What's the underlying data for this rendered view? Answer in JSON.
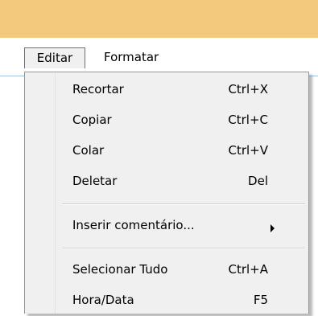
{
  "menubar": {
    "items": [
      {
        "label": "Editar"
      },
      {
        "label": "Formatar"
      }
    ]
  },
  "menu": {
    "items": [
      {
        "label": "Recortar",
        "shortcut": "Ctrl+X"
      },
      {
        "label": "Copiar",
        "shortcut": "Ctrl+C"
      },
      {
        "label": "Colar",
        "shortcut": "Ctrl+V"
      },
      {
        "label": "Deletar",
        "shortcut": "Del"
      },
      {
        "label": "Inserir comentário...",
        "icon": "submenu-arrow-icon"
      },
      {
        "label": "Selecionar Tudo",
        "shortcut": "Ctrl+A"
      },
      {
        "label": "Hora/Data",
        "shortcut": "F5"
      }
    ]
  },
  "colors": {
    "titlebar": "#f3c97d",
    "menu_background": "#f0f0f0",
    "menubar_border": "#9fc3e7"
  }
}
